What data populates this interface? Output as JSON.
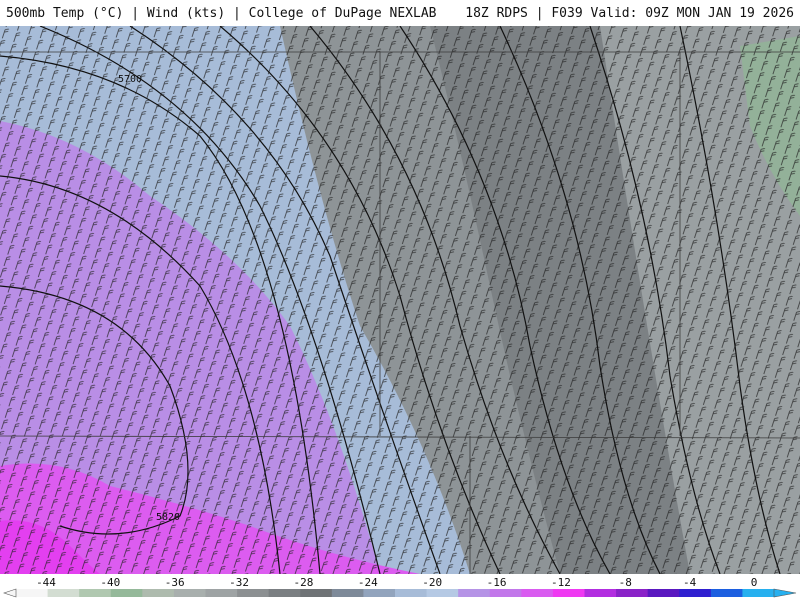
{
  "header": {
    "left": "500mb Temp (°C) | Wind (kts) | College of DuPage NEXLAB",
    "right": "18Z RDPS | F039 Valid: 09Z MON JAN 19 2026"
  },
  "map": {
    "contour_labels": [
      "5700",
      "5820"
    ]
  },
  "colorbar": {
    "ticks": [
      "-44",
      "-40",
      "-36",
      "-32",
      "-28",
      "-24",
      "-20",
      "-16",
      "-12",
      "-8",
      "-4",
      "0"
    ],
    "colors": [
      "#f6f6f6",
      "#d3ddd2",
      "#b0c8b0",
      "#95b99a",
      "#aebbae",
      "#a8afad",
      "#9ea3a4",
      "#8c9092",
      "#7b7f82",
      "#6f7376",
      "#7e8a99",
      "#92a4bd",
      "#a7bcd8",
      "#b5c9e4",
      "#b593e6",
      "#c277ea",
      "#d95bf0",
      "#ef39f2",
      "#b22ee0",
      "#8a22c8",
      "#5a18c0",
      "#2f1fd0",
      "#1c5fe0",
      "#27b0ef"
    ]
  }
}
